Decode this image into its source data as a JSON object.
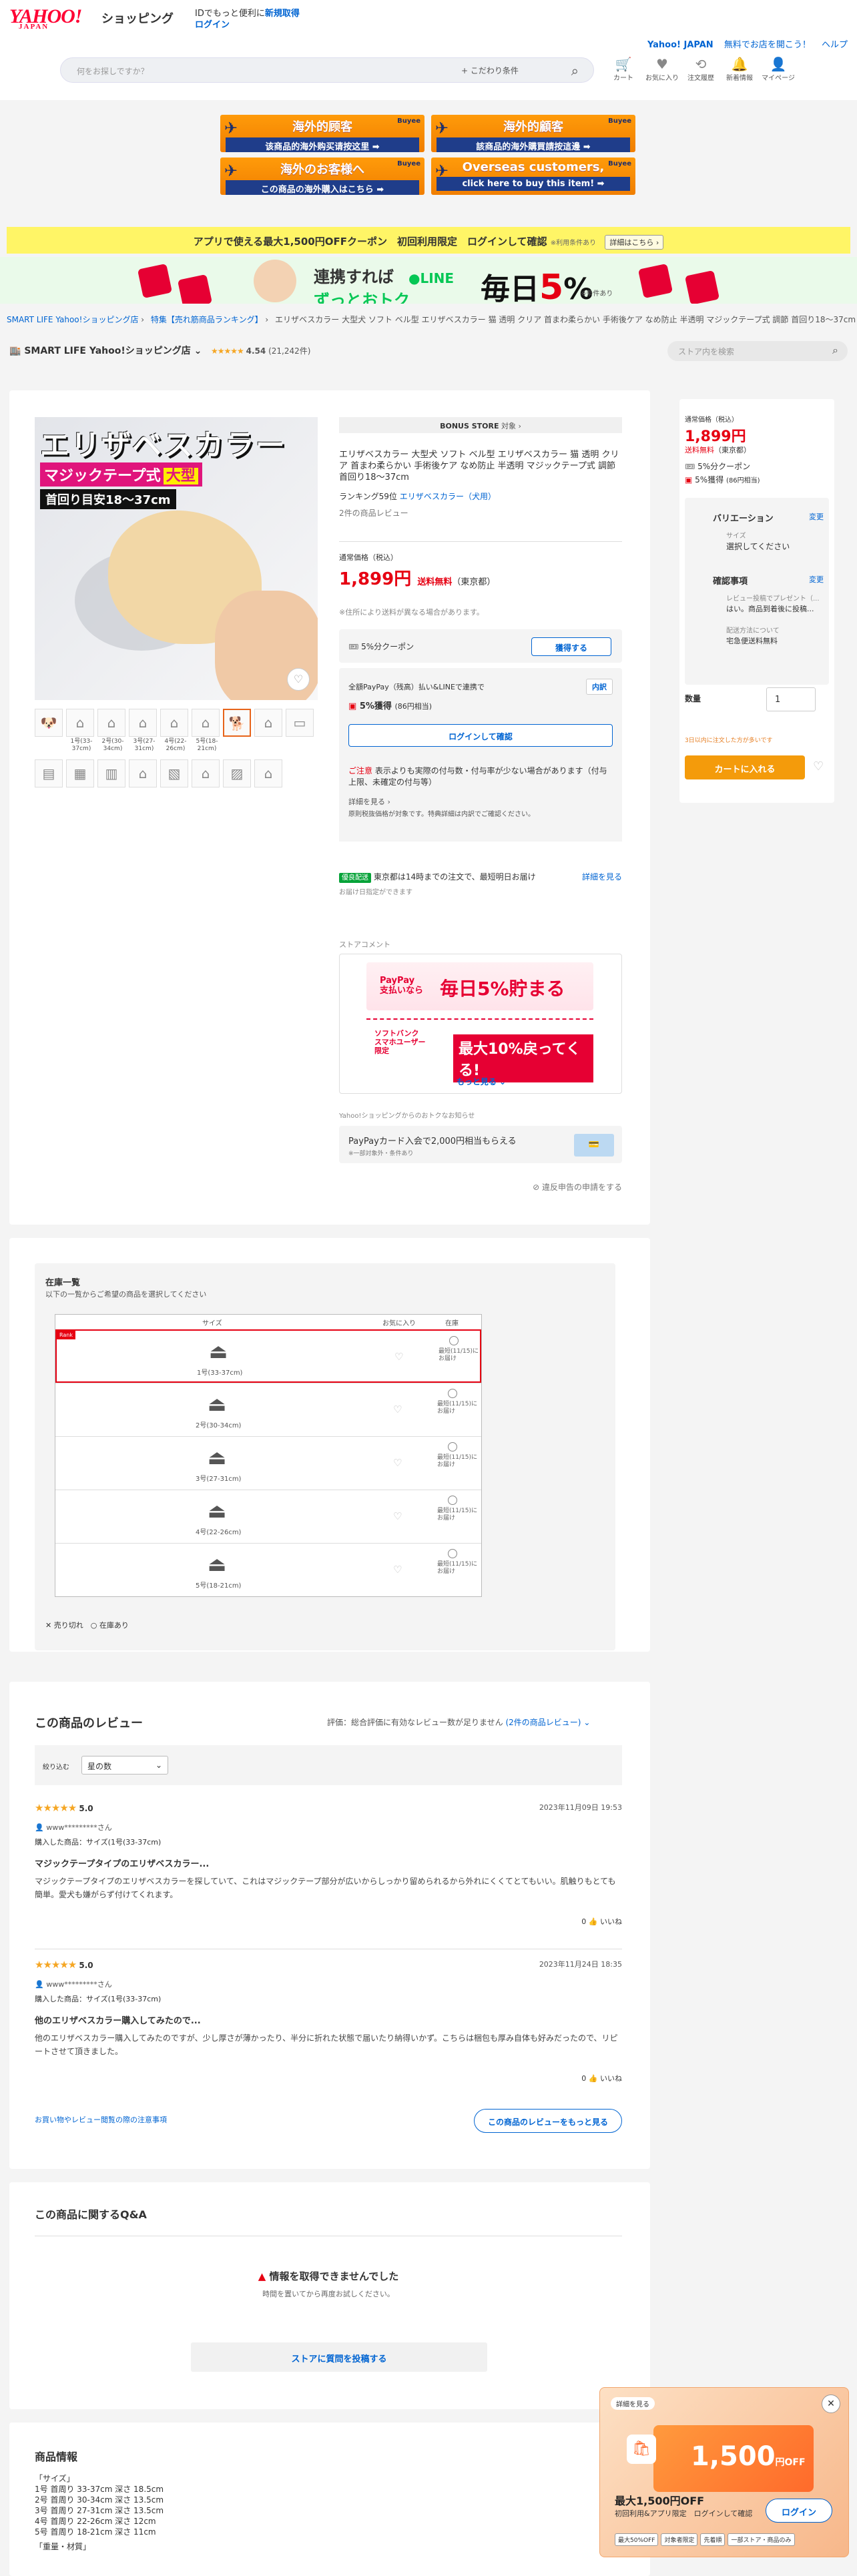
{
  "header": {
    "logo": "YAHOO!",
    "logo_sub": "JAPAN",
    "shopping": "ショッピング",
    "lead_text": "IDでもっと便利に",
    "signup": "新規取得",
    "login": "ログイン",
    "links": [
      "Yahoo! JAPAN",
      "無料でお店を開こう！",
      "ヘルプ"
    ],
    "search_placeholder": "何をお探しですか？",
    "search_condition": "+ こだわり条件",
    "nav": [
      "カート",
      "お気に入り",
      "注文履歴",
      "新着情報",
      "マイページ"
    ]
  },
  "buyee": [
    {
      "t1": "海外的顾客",
      "t2": "该商品的海外购买请按这里 ➡"
    },
    {
      "t1": "海外的顧客",
      "t2": "該商品的海外購買請按這邊 ➡"
    },
    {
      "t1": "海外のお客様へ",
      "t2": "この商品の海外購入はこちら ➡"
    },
    {
      "t1": "Overseas customers,",
      "t2": "click here to buy this item! ➡"
    }
  ],
  "buyee_brand": "Buyee",
  "app_banner": {
    "text": "アプリで使える最大1,500円OFFクーポン　初回利用限定　ログインして確認",
    "note": "※利用条件あり",
    "detail": "詳細はこちら ›"
  },
  "line_banner": {
    "t1a": "連携すれば",
    "t1b": "ずっとおトク",
    "every": "毎日",
    "pct": "5",
    "unit": "%",
    "note": "※条件あり"
  },
  "breadcrumb": [
    "SMART LIFE Yahoo!ショッピング店",
    "›",
    "特集【売れ筋商品ランキング】",
    "›",
    "エリザベスカラー 大型犬 ソフト ベル型 エリザベスカラー 猫 透明 クリア 首まわ柔らかい 手術後ケア なめ防止 半透明 マジックテープ式 調節 首回り18〜37cm"
  ],
  "store": {
    "name": "SMART LIFE Yahoo!ショッピング店",
    "stars": "★★★★★",
    "score": "4.54",
    "count": "(21,242件)",
    "search_placeholder": "ストア内を検索"
  },
  "image_text": {
    "h1": "エリザベスカラー",
    "h2": "マジックテープ式",
    "h2b": "大型",
    "h3": "首回り目安18〜37cm"
  },
  "thumb_labels": [
    "1号(33-37cm)",
    "2号(30-34cm)",
    "3号(27-31cm)",
    "4号(22-26cm)",
    "5号(18-21cm)"
  ],
  "product": {
    "bonus": "BONUS STORE",
    "bonus_tail": "対象 ›",
    "title": "エリザベスカラー 大型犬 ソフト ベル型 エリザベスカラー 猫 透明 クリア 首まわ柔らかい 手術後ケア なめ防止 半透明 マジックテープ式 調節 首回り18〜37cm",
    "ranking": "ランキング59位",
    "ranking_cat": "エリザベスカラー（犬用）",
    "reviews": "2件の商品レビュー",
    "price_label": "通常価格（税込）",
    "price": "1,899円",
    "shipping": "送料無料",
    "region": "（東京都）",
    "price_note": "※住所により送料が異なる場合があります。",
    "coupon": "5%分クーポン",
    "coupon_btn": "獲得する",
    "pay_line": "全額PayPay（残高）払い&LINEで連携で",
    "breakdown": "内訳",
    "earn": "5%獲得",
    "earn_pts": "(86円相当)",
    "login_btn": "ログインして確認",
    "caution_head": "ご注意",
    "caution": "表示よりも実際の付与数・付与率が少ない場合があります（付与上限、未確定の付与等）",
    "caution_more": "詳細を見る ›",
    "caution_note": "原則税抜価格が対象です。特典詳細は内訳でご確認ください。",
    "delivery_tag": "優良配送",
    "delivery": "東京都は14時までの注文で、最短明日お届け",
    "delivery_more": "詳細を見る",
    "delivery_note": "お届け日指定ができます",
    "store_comment": "ストアコメント",
    "pp_line1": "PayPay",
    "pp_line2": "支払いなら",
    "pp_big": "毎日5%貯まる",
    "sb_label": "ソフトバンク\nスマホユーザー\n限定",
    "sb_big": "最大10%戻ってくる!",
    "more": "もっと見る ⌄",
    "otoku_label": "Yahoo!ショッピングからのおトクなお知らせ",
    "card_ad": "PayPayカード入会で2,000円相当もらえる",
    "card_ad_note": "※一部対象外・条件あり",
    "report": "違反申告の申請をする"
  },
  "cart": {
    "price_label": "通常価格（税込）",
    "price": "1,899円",
    "shipping": "送料無料",
    "region": "（東京都）",
    "coupon": "5%分クーポン",
    "earn": "5%獲得",
    "earn_pts": "(86円相当)",
    "variation": "バリエーション",
    "change": "変更",
    "size_label": "サイズ",
    "size_value": "選択してください",
    "confirm": "確認事項",
    "confirm_change": "変更",
    "confirm_q": "レビュー投稿でプレゼント（...",
    "confirm_a": "はい。商品到着後に投稿...",
    "ship_label": "配送方法について",
    "ship_value": "宅急便送料無料",
    "qty_label": "数量",
    "qty": "1",
    "qty_note": "3日以内に注文した方が多いです",
    "add_btn": "カートに入れる"
  },
  "stock": {
    "title": "在庫一覧",
    "sub": "以下の一覧からご希望の商品を選択してください",
    "headers": [
      "サイズ",
      "お気に入り",
      "在庫"
    ],
    "ranking_tag": "Rank",
    "rows": [
      {
        "label": "1号(33-37cm)",
        "stock": "最短(11/15)にお届け"
      },
      {
        "label": "2号(30-34cm)",
        "stock": "最短(11/15)にお届け"
      },
      {
        "label": "3号(27-31cm)",
        "stock": "最短(11/15)にお届け"
      },
      {
        "label": "4号(22-26cm)",
        "stock": "最短(11/15)にお届け"
      },
      {
        "label": "5号(18-21cm)",
        "stock": "最短(11/15)にお届け"
      }
    ],
    "legend_sold": "売り切れ",
    "legend_in": "在庫あり"
  },
  "reviews": {
    "title": "この商品のレビュー",
    "eval": "評価：総合評価に有効なレビュー数が足りません",
    "count_link": "(2件の商品レビュー)",
    "filter_label": "絞り込む",
    "filter_value": "星の数",
    "items": [
      {
        "stars": "★★★★★",
        "score": "5.0",
        "date": "2023年11月09日 19:53",
        "user": "www*********さん",
        "purchase": "購入した商品：サイズ(1号(33-37cm)",
        "title": "マジックテープタイプのエリザベスカラー...",
        "body": "マジックテープタイプのエリザベスカラーを探していて、これはマジックテープ部分が広いからしっかり留められるから外れにくくてとてもいい。肌触りもとても簡単。愛犬も嫌がらず付けてくれます。",
        "helpful": "0",
        "helpful_label": "いいね"
      },
      {
        "stars": "★★★★★",
        "score": "5.0",
        "date": "2023年11月24日 18:35",
        "user": "www*********さん",
        "purchase": "購入した商品：サイズ(1号(33-37cm)",
        "title": "他のエリザベスカラー購入してみたので...",
        "body": "他のエリザベスカラー購入してみたのですが、少し厚さが薄かったり、半分に折れた状態で届いたり納得いかず。こちらは梱包も厚み自体も好みだったので、リピートさせて頂きました。",
        "helpful": "0",
        "helpful_label": "いいね"
      }
    ],
    "note_link": "お買い物やレビュー閲覧の際の注意事項",
    "more_btn": "この商品のレビューをもっと見る"
  },
  "qa": {
    "title": "この商品に関するQ&A",
    "error": "情報を取得できませんでした",
    "error_sub": "時間を置いてから再度お試しください。",
    "ask": "ストアに質問を投稿する"
  },
  "item_info": {
    "title": "商品情報",
    "lines": [
      "「サイズ」",
      "1号 首周り 33-37cm 深さ 18.5cm",
      "2号 首周り 30-34cm 深さ 13.5cm",
      "3号 首周り 27-31cm 深さ 13.5cm",
      "4号 首周り 22-26cm 深さ 12cm",
      "5号 首周り 18-21cm 深さ 11cm",
      "「重量・材質」"
    ]
  },
  "popup": {
    "detail": "詳細を見る",
    "big": "1,500",
    "big_unit": "円OFF",
    "title": "最大1,500円OFF",
    "sub": "初回利用&アプリ限定　ログインして確認",
    "login": "ログイン",
    "tags": [
      "最大50%OFF",
      "対象者限定",
      "先着順",
      "一部ストア・商品のみ"
    ]
  }
}
